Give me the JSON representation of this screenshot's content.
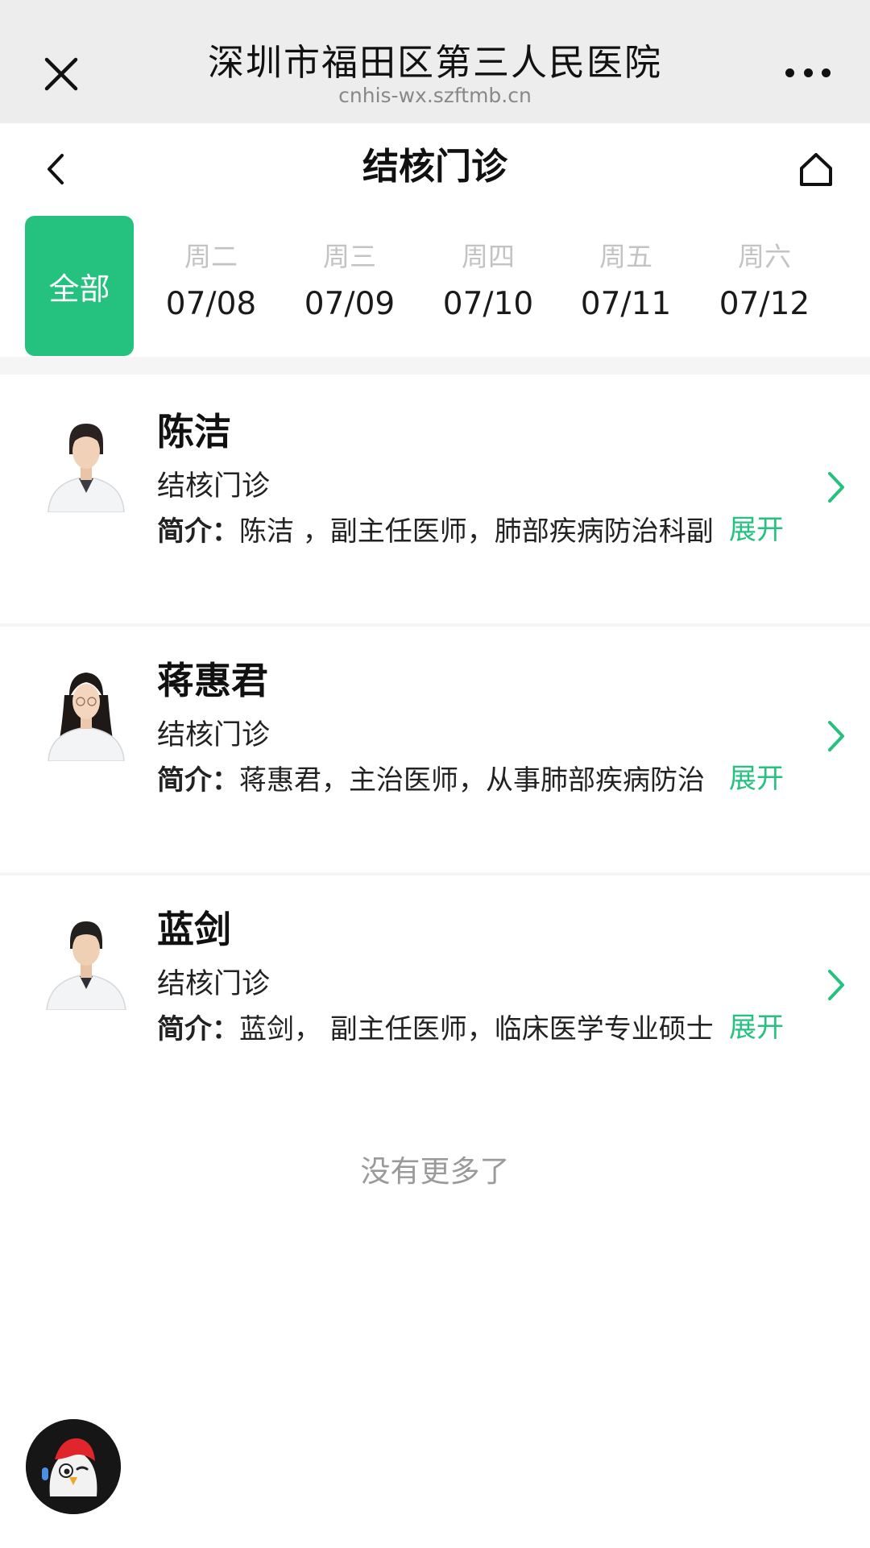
{
  "topbar": {
    "title": "深圳市福田区第三人民医院",
    "url": "cnhis-wx.szftmb.cn",
    "close_icon": "close-icon",
    "more_icon": "more-icon"
  },
  "header": {
    "title": "结核门诊",
    "back_icon": "chevron-left-icon",
    "home_icon": "home-icon"
  },
  "date_strip": {
    "all_label": "全部",
    "days": [
      {
        "weekday": "周二",
        "date": "07/08"
      },
      {
        "weekday": "周三",
        "date": "07/09"
      },
      {
        "weekday": "周四",
        "date": "07/10"
      },
      {
        "weekday": "周五",
        "date": "07/11"
      },
      {
        "weekday": "周六",
        "date": "07/12"
      }
    ],
    "active": "全部"
  },
  "doctors": [
    {
      "name": "陈洁",
      "dept": "结核门诊",
      "intro_label": "简介：",
      "intro": "陈洁 ，副主任医师，肺部疾病防治科副",
      "expand": "展开"
    },
    {
      "name": "蒋惠君",
      "dept": "结核门诊",
      "intro_label": "简介：",
      "intro": "蒋惠君，主治医师，从事肺部疾病防治",
      "expand": "展开"
    },
    {
      "name": "蓝剑",
      "dept": "结核门诊",
      "intro_label": "简介：",
      "intro": "蓝剑，  副主任医师，临床医学专业硕士",
      "expand": "展开"
    }
  ],
  "footer": {
    "no_more": "没有更多了"
  },
  "colors": {
    "accent": "#25c17e",
    "topbar_bg": "#ededed",
    "muted_text": "#9a9a9a"
  },
  "assistant": {
    "icon": "assistant-bird-icon"
  }
}
